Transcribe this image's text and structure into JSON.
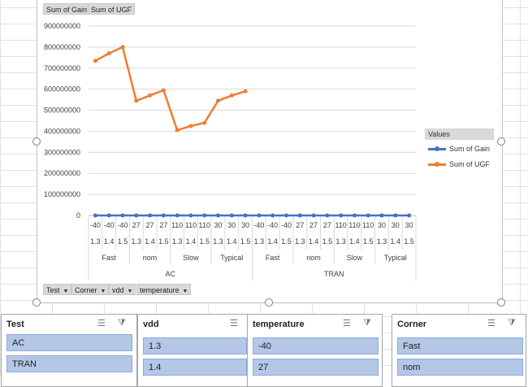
{
  "chart_data": {
    "type": "line",
    "y_ticks": [
      "900000000",
      "800000000",
      "700000000",
      "600000000",
      "500000000",
      "400000000",
      "300000000",
      "200000000",
      "100000000",
      "0"
    ],
    "ylim": [
      0,
      900000000
    ],
    "temperature_labels": [
      "-40",
      "-40",
      "-40",
      "27",
      "27",
      "27",
      "110",
      "110",
      "110",
      "30",
      "30",
      "30",
      "-40",
      "-40",
      "-40",
      "27",
      "27",
      "27",
      "110",
      "110",
      "110",
      "30",
      "30",
      "30"
    ],
    "vdd_labels": [
      "1.3",
      "1.4",
      "1.5",
      "1.3",
      "1.4",
      "1.5",
      "1.3",
      "1.4",
      "1.5",
      "1.3",
      "1.4",
      "1.5",
      "1.3",
      "1.4",
      "1.5",
      "1.3",
      "1.4",
      "1.5",
      "1.3",
      "1.4",
      "1.5",
      "1.3",
      "1.4",
      "1.5"
    ],
    "corner_labels": [
      "Fast",
      "nom",
      "Slow",
      "Typical",
      "Fast",
      "nom",
      "Slow",
      "Typical"
    ],
    "test_labels": [
      "AC",
      "TRAN"
    ],
    "series": [
      {
        "name": "Sum of Gain",
        "color": "#4472c4",
        "values": [
          0,
          0,
          0,
          0,
          0,
          0,
          0,
          0,
          0,
          0,
          0,
          0,
          0,
          0,
          0,
          0,
          0,
          0,
          0,
          0,
          0,
          0,
          0,
          0
        ]
      },
      {
        "name": "Sum of UGF",
        "color": "#ed7d31",
        "values": [
          735000000,
          770000000,
          800000000,
          545000000,
          570000000,
          595000000,
          405000000,
          425000000,
          440000000,
          545000000,
          570000000,
          590000000,
          null,
          null,
          null,
          null,
          null,
          null,
          null,
          null,
          null,
          null,
          null,
          null
        ]
      }
    ],
    "legend_title": "Values",
    "legend_position": "right",
    "grid": true
  },
  "value_buttons": [
    "Sum of Gain",
    "Sum of UGF"
  ],
  "axis_buttons": [
    "Test",
    "Corner",
    "vdd",
    "temperature"
  ],
  "slicers": [
    {
      "title": "Test",
      "items": [
        "AC",
        "TRAN"
      ]
    },
    {
      "title": "vdd",
      "items": [
        "1.3",
        "1.4"
      ]
    },
    {
      "title": "temperature",
      "items": [
        "-40",
        "27"
      ]
    },
    {
      "title": "Corner",
      "items": [
        "Fast",
        "nom"
      ]
    }
  ]
}
